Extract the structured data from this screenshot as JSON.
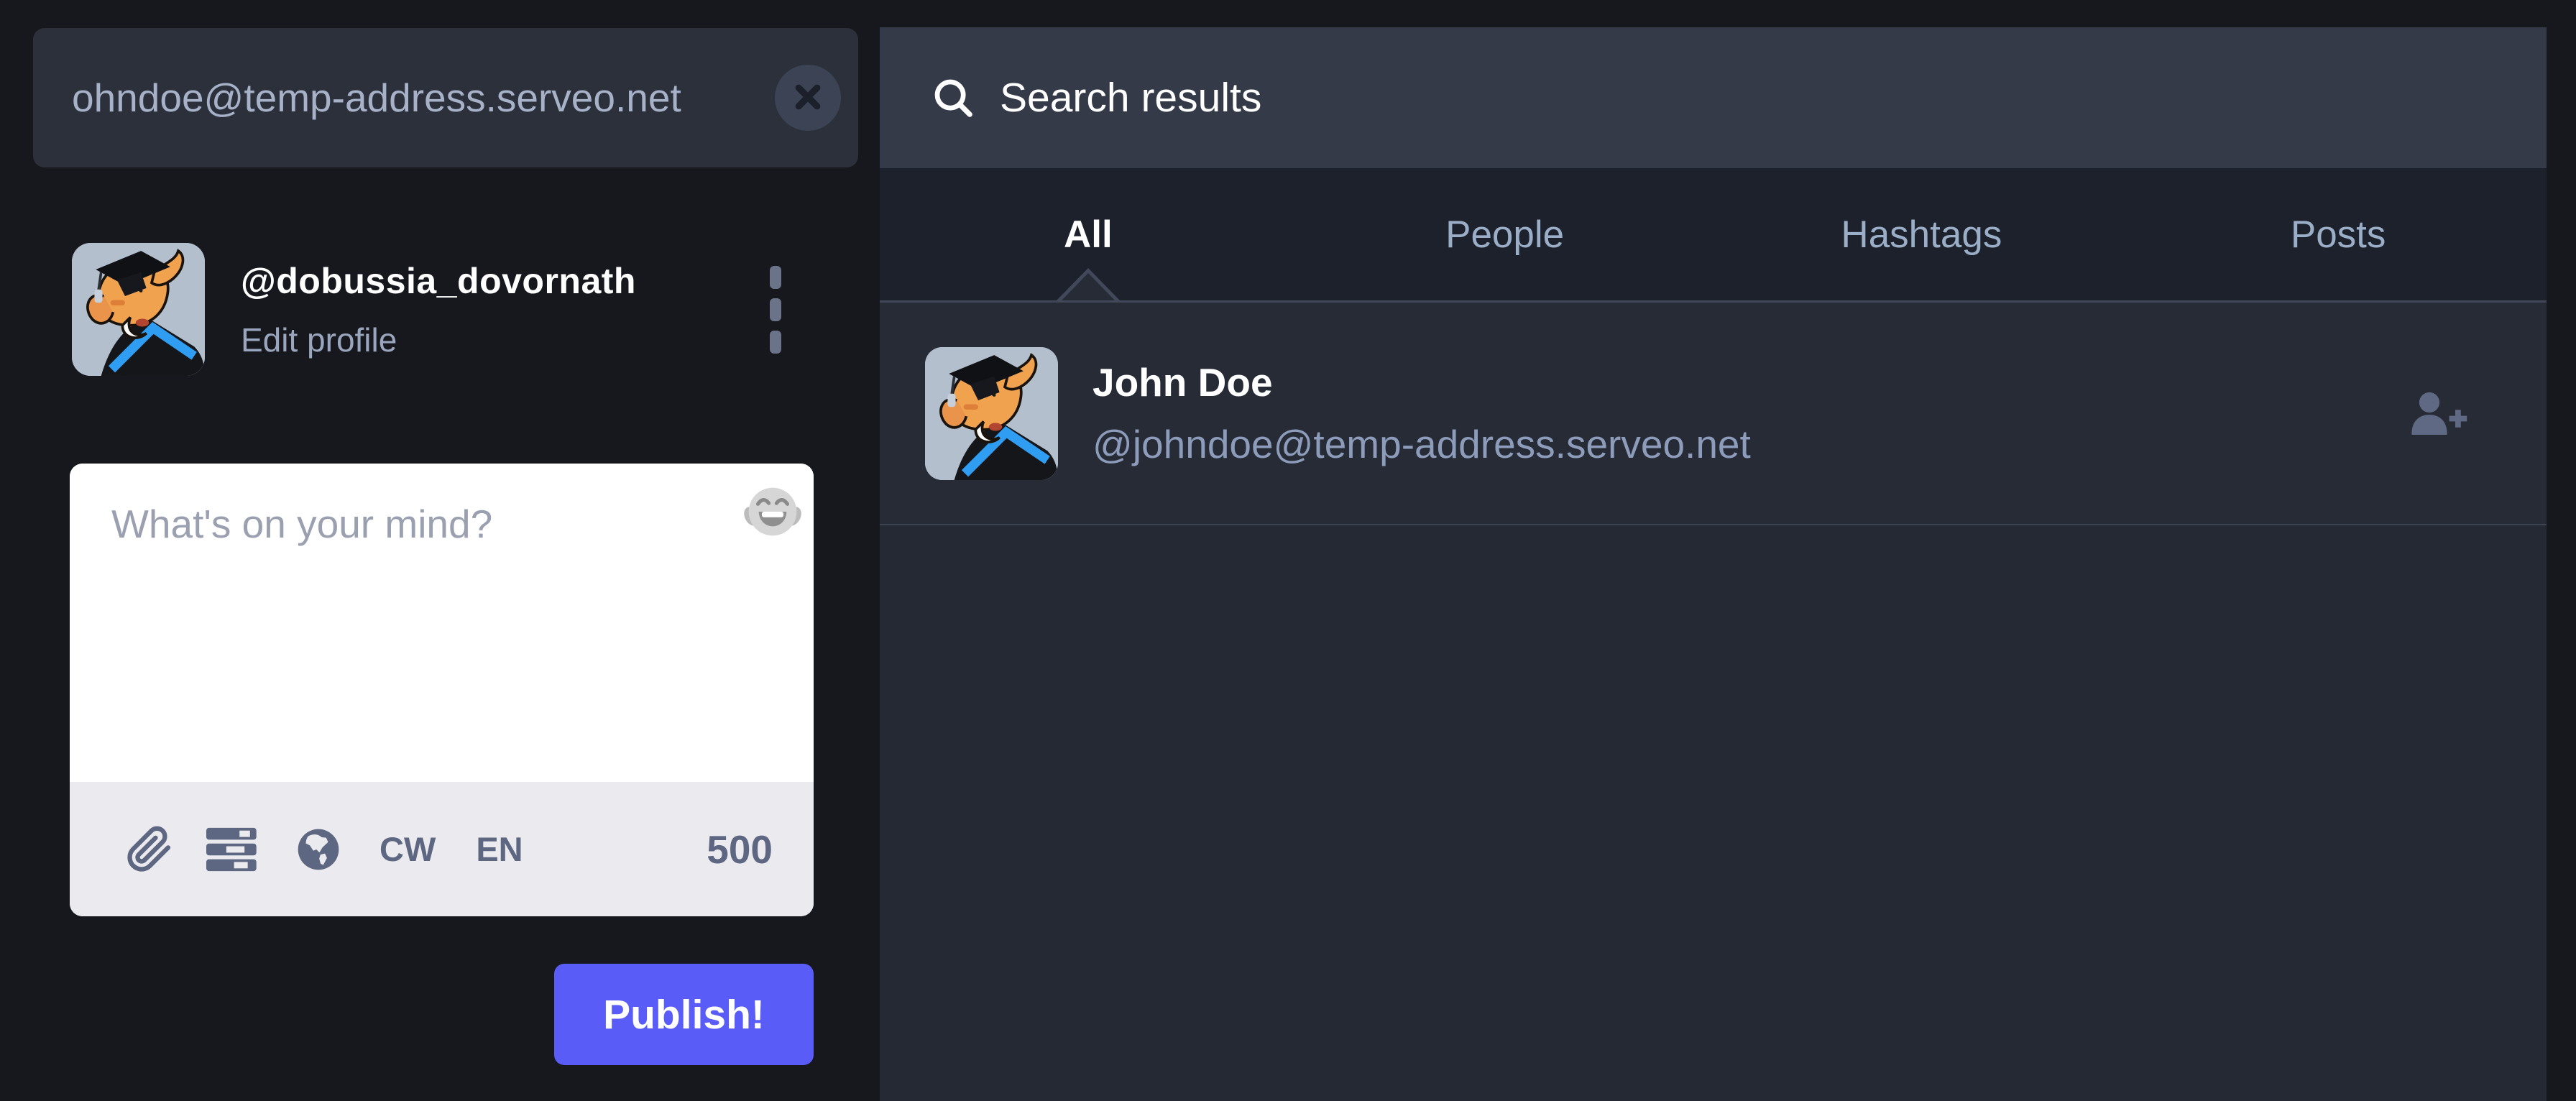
{
  "colors": {
    "accent": "#595cf7",
    "app_background": "#16181d",
    "column_header": "#343a48",
    "tab_bar": "#1d212b",
    "result_row": "#262b36",
    "content_background": "#242933",
    "composer_background": "#ffffff",
    "toolbar_background": "#ebebef",
    "icon_slate": "#5e6781",
    "muted_text": "#9baec8"
  },
  "drawer": {
    "search": {
      "value": "ohndoe@temp-address.serveo.net",
      "clear_icon": "circle-x"
    },
    "profile": {
      "username": "@dobussia_dovornath",
      "edit_profile_label": "Edit profile",
      "avatar_icon": "mastodon-graduate-elephant",
      "menu_icon": "ellipsis-vertical"
    },
    "composer": {
      "placeholder": "What's on your mind?",
      "emoji_icon": "face-with-tears-of-joy",
      "toolbar": {
        "attach_icon": "paperclip",
        "poll_icon": "poll-bars",
        "privacy_icon": "globe",
        "content_warning_label": "CW",
        "language_label": "EN",
        "characters_remaining": "500"
      },
      "publish_label": "Publish!"
    }
  },
  "main": {
    "header": {
      "icon": "search",
      "title": "Search results"
    },
    "tabs": [
      {
        "label": "All",
        "active": true
      },
      {
        "label": "People",
        "active": false
      },
      {
        "label": "Hashtags",
        "active": false
      },
      {
        "label": "Posts",
        "active": false
      }
    ],
    "results": [
      {
        "display_name": "John Doe",
        "handle": "@johndoe@temp-address.serveo.net",
        "avatar_icon": "mastodon-graduate-elephant",
        "action_icon": "user-plus"
      }
    ]
  }
}
